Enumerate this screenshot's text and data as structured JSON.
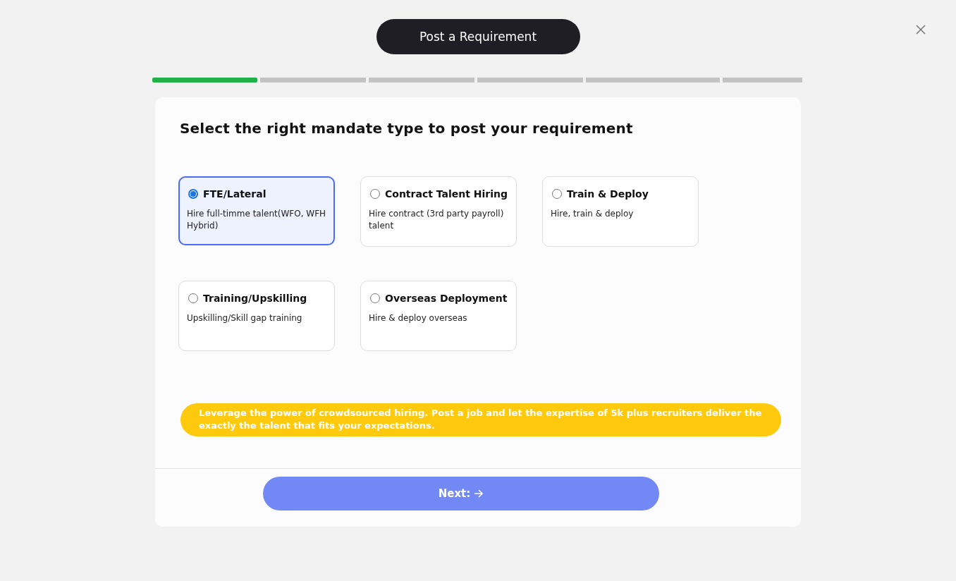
{
  "header": {
    "title": "Post a Requirement"
  },
  "progress": {
    "steps": [
      {
        "done": true
      },
      {
        "done": false
      },
      {
        "done": false
      },
      {
        "done": false
      },
      {
        "done": false
      },
      {
        "done": false
      }
    ]
  },
  "card": {
    "heading": "Select the right mandate type to post your requirement",
    "options": [
      {
        "title": "FTE/Lateral",
        "description": "Hire full-timme talent(WFO, WFH Hybrid)",
        "selected": true
      },
      {
        "title": "Contract Talent Hiring",
        "description": "Hire contract (3rd party payroll) talent",
        "selected": false
      },
      {
        "title": "Train & Deploy",
        "description": "Hire, train & deploy",
        "selected": false
      },
      {
        "title": "Training/Upskilling",
        "description": "Upskilling/Skill gap training",
        "selected": false
      },
      {
        "title": "Overseas Deployment",
        "description": "Hire & deploy overseas",
        "selected": false
      }
    ],
    "banner": "Leverage the power of crowdsourced hiring. Post a job and let the expertise of 5k plus recruiters deliver the exactly the talent that  fits your expectations.",
    "next_button": "Next:"
  }
}
